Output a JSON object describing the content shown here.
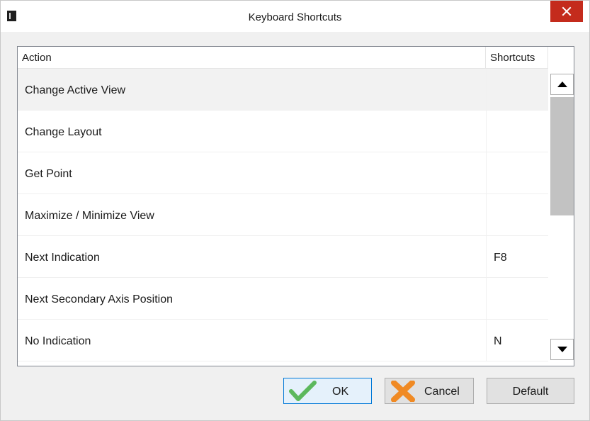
{
  "window": {
    "title": "Keyboard Shortcuts",
    "close_icon": "close-icon",
    "app_icon": "app-icon"
  },
  "table": {
    "columns": [
      "Action",
      "Shortcuts"
    ],
    "rows": [
      {
        "action": "Change Active View",
        "shortcut": "",
        "selected": true
      },
      {
        "action": "Change Layout",
        "shortcut": ""
      },
      {
        "action": "Get Point",
        "shortcut": ""
      },
      {
        "action": "Maximize / Minimize View",
        "shortcut": ""
      },
      {
        "action": "Next Indication",
        "shortcut": "F8"
      },
      {
        "action": "Next Secondary Axis Position",
        "shortcut": ""
      },
      {
        "action": "No Indication",
        "shortcut": "N"
      }
    ],
    "scroll_up_icon": "triangle-up-icon",
    "scroll_down_icon": "triangle-down-icon"
  },
  "buttons": {
    "ok": {
      "label": "OK",
      "icon": "checkmark-icon"
    },
    "cancel": {
      "label": "Cancel",
      "icon": "x-mark-icon"
    },
    "default": {
      "label": "Default"
    }
  },
  "colors": {
    "close_red": "#c42b1c",
    "ok_green": "#5cb85c",
    "cancel_orange": "#f08a24",
    "selected_row": "#f2f2f2",
    "ok_border": "#0078d7"
  }
}
